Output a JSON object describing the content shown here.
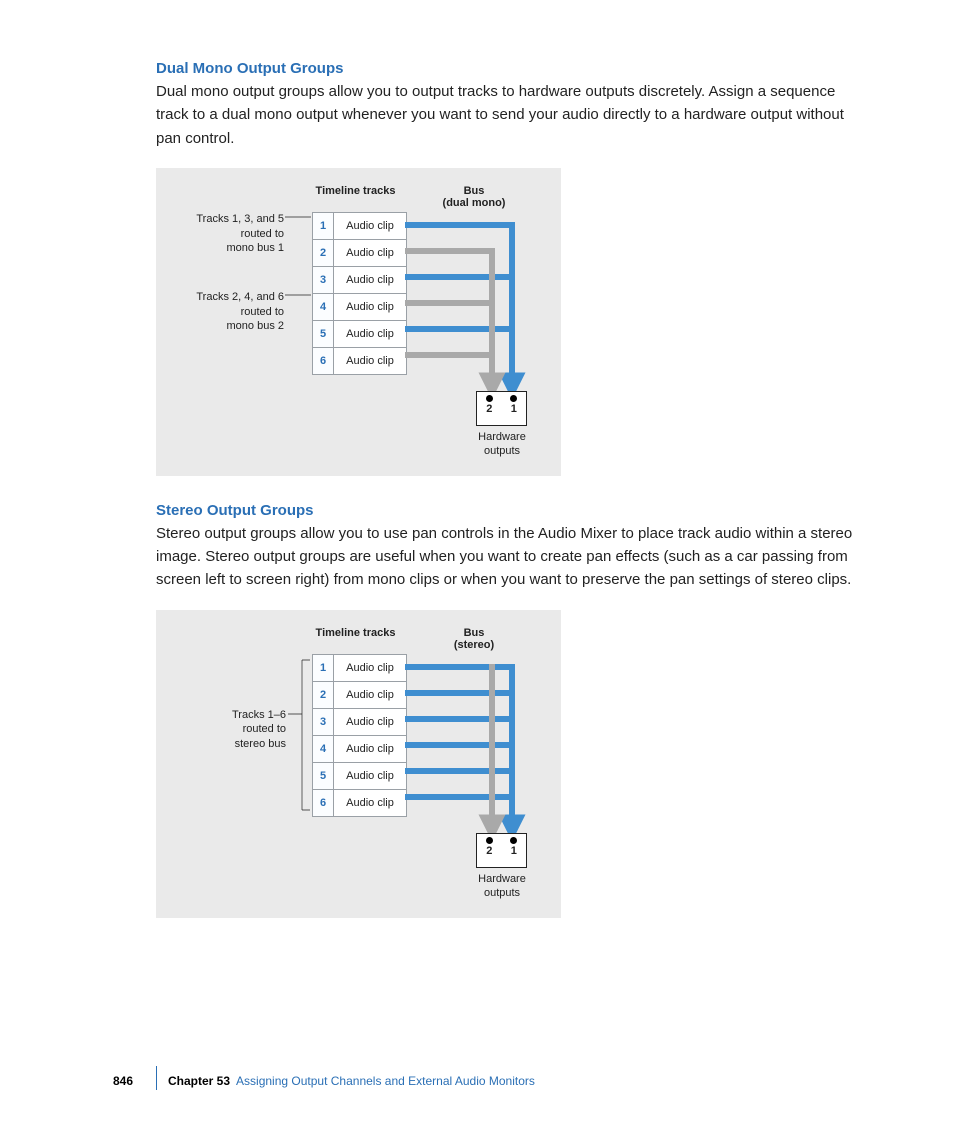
{
  "section1": {
    "heading": "Dual Mono Output Groups",
    "body": "Dual mono output groups allow you to output tracks to hardware outputs discretely. Assign a sequence track to a dual mono output whenever you want to send your audio directly to a hardware output without pan control."
  },
  "section2": {
    "heading": "Stereo Output Groups",
    "body": "Stereo output groups allow you to use pan controls in the Audio Mixer to place track audio within a stereo image. Stereo output groups are useful when you want to create pan effects (such as a car passing from screen left to screen right) from mono clips or when you want to preserve the pan settings of stereo clips."
  },
  "fig1": {
    "timeline_label": "Timeline tracks",
    "bus_label_line1": "Bus",
    "bus_label_line2": "(dual mono)",
    "tracks": [
      {
        "n": "1",
        "clip": "Audio clip"
      },
      {
        "n": "2",
        "clip": "Audio clip"
      },
      {
        "n": "3",
        "clip": "Audio clip"
      },
      {
        "n": "4",
        "clip": "Audio clip"
      },
      {
        "n": "5",
        "clip": "Audio clip"
      },
      {
        "n": "6",
        "clip": "Audio clip"
      }
    ],
    "anno1_line1": "Tracks 1, 3, and 5",
    "anno1_line2": "routed to",
    "anno1_line3": "mono bus 1",
    "anno2_line1": "Tracks 2, 4, and 6",
    "anno2_line2": "routed to",
    "anno2_line3": "mono bus 2",
    "hw_port_left": "2",
    "hw_port_right": "1",
    "hw_caption_line1": "Hardware",
    "hw_caption_line2": "outputs"
  },
  "fig2": {
    "timeline_label": "Timeline tracks",
    "bus_label_line1": "Bus",
    "bus_label_line2": "(stereo)",
    "tracks": [
      {
        "n": "1",
        "clip": "Audio clip"
      },
      {
        "n": "2",
        "clip": "Audio clip"
      },
      {
        "n": "3",
        "clip": "Audio clip"
      },
      {
        "n": "4",
        "clip": "Audio clip"
      },
      {
        "n": "5",
        "clip": "Audio clip"
      },
      {
        "n": "6",
        "clip": "Audio clip"
      }
    ],
    "anno_line1": "Tracks 1–6",
    "anno_line2": "routed to",
    "anno_line3": "stereo bus",
    "hw_port_left": "2",
    "hw_port_right": "1",
    "hw_caption_line1": "Hardware",
    "hw_caption_line2": "outputs"
  },
  "footer": {
    "page": "846",
    "chapter_prefix": "Chapter 53",
    "chapter_title": "Assigning Output Channels and External Audio Monitors"
  },
  "colors": {
    "blue": "#2a6fb5",
    "grey": "#a9a9a9",
    "figbg": "#eaeaea"
  }
}
